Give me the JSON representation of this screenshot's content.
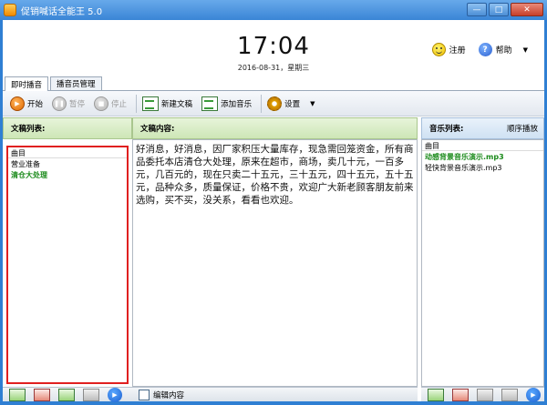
{
  "window": {
    "title": "促销喊话全能王 5.0"
  },
  "clock": {
    "time": "17:04",
    "date": "2016-08-31，星期三"
  },
  "header": {
    "register_label": "注册",
    "help_label": "帮助"
  },
  "tabs": [
    {
      "label": "即时播音",
      "active": true
    },
    {
      "label": "播音员管理",
      "active": false
    }
  ],
  "toolbar": {
    "start": "开始",
    "pause": "暂停",
    "stop": "停止",
    "new_doc": "新建文稿",
    "add_music": "添加音乐",
    "settings": "设置"
  },
  "panels": {
    "docs_title": "文稿列表:",
    "content_title": "文稿内容:",
    "music_title": "音乐列表:",
    "play_mode": "顺序播放"
  },
  "doc_list": {
    "header": "曲目",
    "items": [
      {
        "label": "营业准备",
        "selected": false
      },
      {
        "label": "清仓大处理",
        "selected": true
      }
    ]
  },
  "content_text": "好消息，好消息，因厂家积压大量库存，现急需回笼资金，所有商品委托本店清仓大处理，原来在超市，商场，卖几十元，一百多元，几百元的，现在只卖二十五元，三十五元，四十五元，五十五元，品种众多，质量保证，价格不贵，欢迎广大新老顾客朋友前来选购，买不买，没关系，看看也欢迎。",
  "music_list": {
    "header": "曲目",
    "items": [
      {
        "label": "动感背景音乐演示.mp3",
        "selected": true
      },
      {
        "label": "轻快背景音乐演示.mp3",
        "selected": false
      }
    ]
  },
  "bottom": {
    "edit_label": "编辑内容"
  },
  "colors": {
    "selected_text": "#1a8a1a",
    "highlight_border": "#e02020",
    "titlebar": "#3a85d6"
  }
}
